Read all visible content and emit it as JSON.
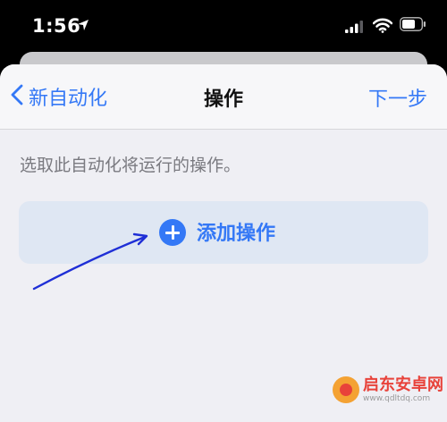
{
  "status_bar": {
    "time": "1:56"
  },
  "navbar": {
    "back_label": "新自动化",
    "title": "操作",
    "next_label": "下一步"
  },
  "main": {
    "hint": "选取此自动化将运行的操作。",
    "add_action_label": "添加操作"
  },
  "colors": {
    "accent": "#3478f6",
    "annotation_arrow": "#1f2fd6"
  },
  "watermark": {
    "name": "启东安卓网",
    "url": "www.qdltdq.com"
  }
}
